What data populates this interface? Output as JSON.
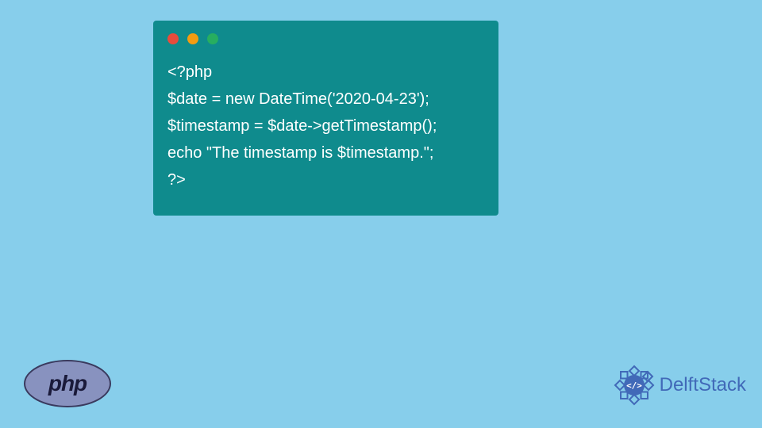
{
  "code": {
    "line1": "<?php",
    "line2": "$date = new DateTime('2020-04-23');",
    "line3": "$timestamp = $date->getTimestamp();",
    "line4": "echo \"The timestamp is $timestamp.\";",
    "line5": "?>"
  },
  "phpLogo": {
    "text": "php"
  },
  "delftstack": {
    "text": "DelftStack"
  }
}
